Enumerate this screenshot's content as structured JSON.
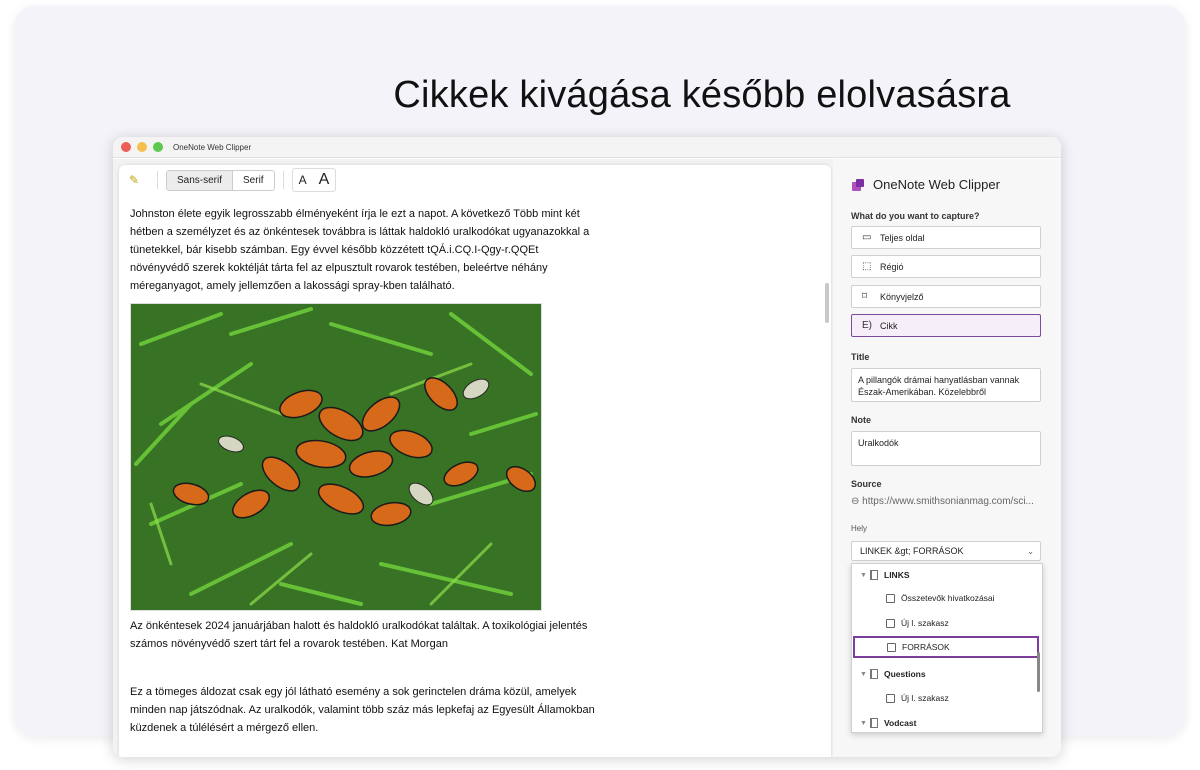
{
  "page": {
    "headline": "Cikkek kivágása később elolvasásra"
  },
  "window": {
    "title": "OneNote Web Clipper"
  },
  "toolbar": {
    "sans": "Sans-serif",
    "serif": "Serif",
    "small_a": "A",
    "big_a": "A"
  },
  "article": {
    "paragraph1": "Johnston élete egyik legrosszabb élményeként írja le ezt a napot. A következő Több mint két hétben a személyzet és az önkéntesek továbbra is láttak haldokló uralkodókat ugyanazokkal a tünetekkel, bár kisebb számban. Egy évvel később közzétett tQÁ.i.CQ.I-Qgy-r.QQEt növényvédő szerek koktélját tárta fel az elpusztult rovarok testében, beleértve néhány méreganyagot, amely jellemzően a lakossági spray-kben található.",
    "caption": "Az önkéntesek 2024 januárjában halott és haldokló uralkodókat találtak. A toxikológiai jelentés számos növényvédő szert tárt fel a rovarok testében. Kat Morgan",
    "paragraph3": "Ez a tömeges áldozat csak egy jól látható esemény a sok gerinctelen dráma közül, amelyek minden nap játszódnak. Az uralkodók, valamint több száz más lepkefaj az Egyesült Államokban küzdenek a túlélésért a mérgező ellen."
  },
  "panel": {
    "title": "OneNote Web Clipper",
    "capture_label": "What do you want to capture?",
    "modes": [
      {
        "label": "Teljes oldal"
      },
      {
        "label": "Régió"
      },
      {
        "label": "Könyvjelző"
      },
      {
        "label": "Cikk"
      }
    ],
    "title_label": "Title",
    "title_value": "A pillangók drámai hanyatlásban vannak Észak-Amerikában. Közelebbről",
    "note_label": "Note",
    "note_value": "Uralkodók",
    "source_label": "Source",
    "source_value": "https://www.smithsonianmag.com/sci...",
    "location_label": "Hely",
    "location_value": "LINKEK &gt; FORRÁSOK",
    "tree": [
      {
        "label": "LINKS"
      },
      {
        "label": "Összetevők hivatkozásai"
      },
      {
        "label": "Új l. szakasz"
      },
      {
        "label": "FORRÁSOK"
      },
      {
        "label": "Questions"
      },
      {
        "label": "Új l. szakasz"
      },
      {
        "label": "Vodcast"
      }
    ]
  }
}
